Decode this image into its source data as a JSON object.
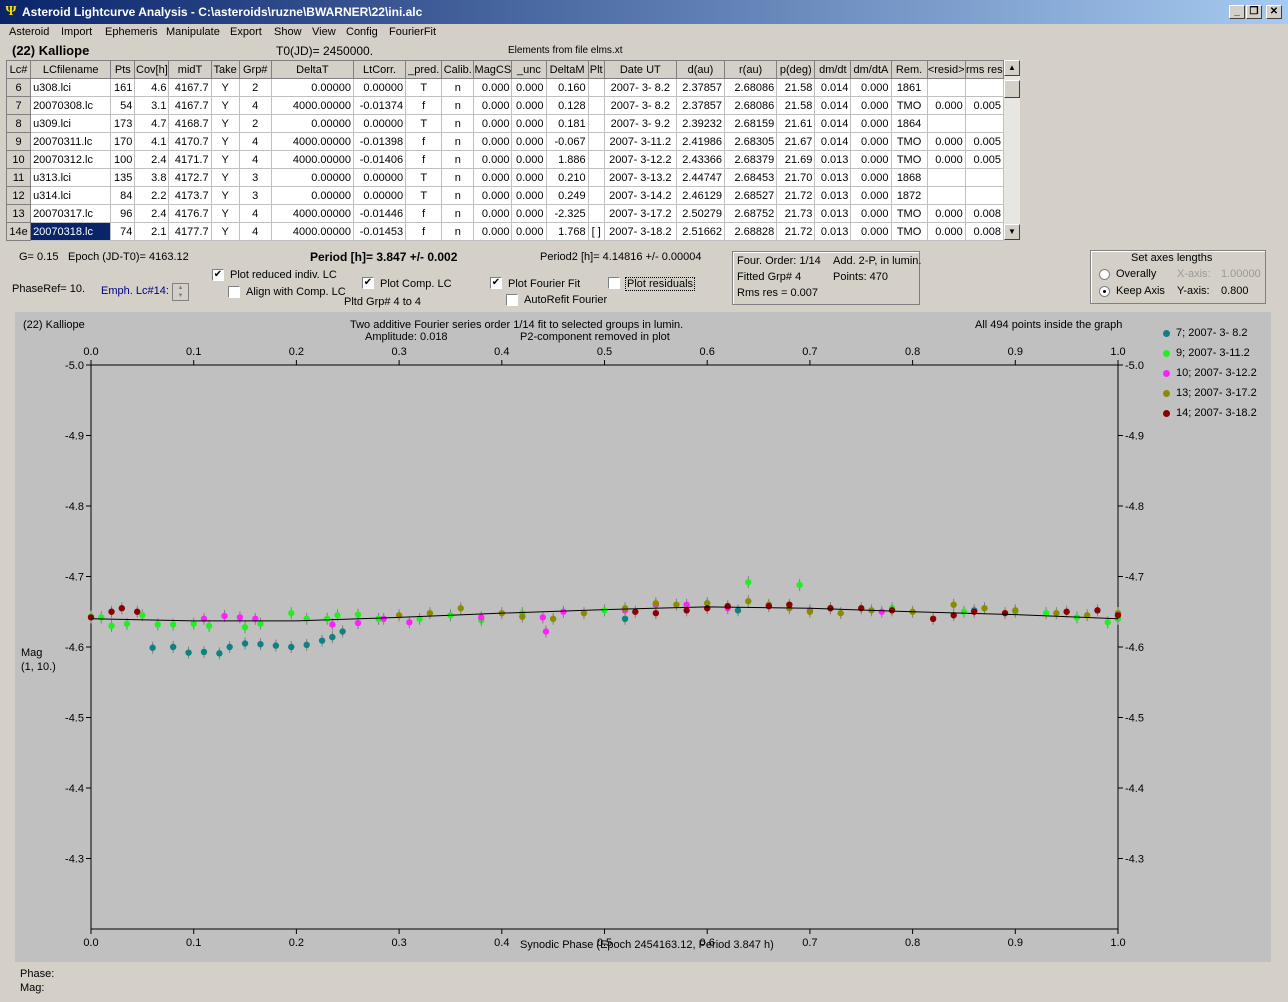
{
  "window": {
    "title": "Asteroid Lightcurve Analysis - C:\\asteroids\\ruzne\\BWARNER\\22\\ini.alc",
    "minimize": "_",
    "restore": "❐",
    "close": "✕"
  },
  "menu": [
    "Asteroid",
    "Import",
    "Ephemeris",
    "Manipulate",
    "Export",
    "Show",
    "View",
    "Config",
    "FourierFit"
  ],
  "header": {
    "asteroid": "(22) Kalliope",
    "t0": "T0(JD)= 2450000.",
    "elements": "Elements from file elms.xt"
  },
  "table": {
    "columns": [
      "Lc#",
      "LCfilename",
      "Pts",
      "Cov[h]",
      "midT",
      "Take",
      "Grp#",
      "DeltaT",
      "LtCorr.",
      "_pred.",
      "Calib.",
      "MagCS",
      "_unc",
      "DeltaM",
      "Plt",
      "Date UT",
      "d(au)",
      "r(au)",
      "p(deg)",
      "dm/dt",
      "dm/dtA",
      "Rem.",
      "<resid>",
      "rms res"
    ],
    "rows": [
      [
        "6",
        "u308.lci",
        "161",
        "4.6",
        "4167.7",
        "Y",
        "2",
        "0.00000",
        "0.00000",
        "T",
        "n",
        "0.000",
        "0.000",
        "0.160",
        "",
        "2007- 3- 8.2",
        "2.37857",
        "2.68086",
        "21.58",
        "0.014",
        "0.000",
        "1861",
        "",
        ""
      ],
      [
        "7",
        "20070308.lc",
        "54",
        "3.1",
        "4167.7",
        "Y",
        "4",
        "4000.00000",
        "-0.01374",
        "f",
        "n",
        "0.000",
        "0.000",
        "0.128",
        "",
        "2007- 3- 8.2",
        "2.37857",
        "2.68086",
        "21.58",
        "0.014",
        "0.000",
        "TMO",
        "0.000",
        "0.005"
      ],
      [
        "8",
        "u309.lci",
        "173",
        "4.7",
        "4168.7",
        "Y",
        "2",
        "0.00000",
        "0.00000",
        "T",
        "n",
        "0.000",
        "0.000",
        "0.181",
        "",
        "2007- 3- 9.2",
        "2.39232",
        "2.68159",
        "21.61",
        "0.014",
        "0.000",
        "1864",
        "",
        ""
      ],
      [
        "9",
        "20070311.lc",
        "170",
        "4.1",
        "4170.7",
        "Y",
        "4",
        "4000.00000",
        "-0.01398",
        "f",
        "n",
        "0.000",
        "0.000",
        "-0.067",
        "",
        "2007- 3-11.2",
        "2.41986",
        "2.68305",
        "21.67",
        "0.014",
        "0.000",
        "TMO",
        "0.000",
        "0.005"
      ],
      [
        "10",
        "20070312.lc",
        "100",
        "2.4",
        "4171.7",
        "Y",
        "4",
        "4000.00000",
        "-0.01406",
        "f",
        "n",
        "0.000",
        "0.000",
        "1.886",
        "",
        "2007- 3-12.2",
        "2.43366",
        "2.68379",
        "21.69",
        "0.013",
        "0.000",
        "TMO",
        "0.000",
        "0.005"
      ],
      [
        "11",
        "u313.lci",
        "135",
        "3.8",
        "4172.7",
        "Y",
        "3",
        "0.00000",
        "0.00000",
        "T",
        "n",
        "0.000",
        "0.000",
        "0.210",
        "",
        "2007- 3-13.2",
        "2.44747",
        "2.68453",
        "21.70",
        "0.013",
        "0.000",
        "1868",
        "",
        ""
      ],
      [
        "12",
        "u314.lci",
        "84",
        "2.2",
        "4173.7",
        "Y",
        "3",
        "0.00000",
        "0.00000",
        "T",
        "n",
        "0.000",
        "0.000",
        "0.249",
        "",
        "2007- 3-14.2",
        "2.46129",
        "2.68527",
        "21.72",
        "0.013",
        "0.000",
        "1872",
        "",
        ""
      ],
      [
        "13",
        "20070317.lc",
        "96",
        "2.4",
        "4176.7",
        "Y",
        "4",
        "4000.00000",
        "-0.01446",
        "f",
        "n",
        "0.000",
        "0.000",
        "-2.325",
        "",
        "2007- 3-17.2",
        "2.50279",
        "2.68752",
        "21.73",
        "0.013",
        "0.000",
        "TMO",
        "0.000",
        "0.008"
      ],
      [
        "14e",
        "20070318.lc",
        "74",
        "2.1",
        "4177.7",
        "Y",
        "4",
        "4000.00000",
        "-0.01453",
        "f",
        "n",
        "0.000",
        "0.000",
        "1.768",
        "[ ]",
        "2007- 3-18.2",
        "2.51662",
        "2.68828",
        "21.72",
        "0.013",
        "0.000",
        "TMO",
        "0.000",
        "0.008"
      ]
    ],
    "selected_row": 8
  },
  "controls": {
    "g": "G= 0.15",
    "epoch": "Epoch (JD-T0)= 4163.12",
    "period": "Period [h]= 3.847 +/- 0.002",
    "period2": "Period2 [h]= 4.14816 +/- 0.00004",
    "phaseref": "PhaseRef= 10.",
    "emph": "Emph. Lc#14:",
    "plot_reduced": {
      "label": "Plot reduced indiv. LC",
      "checked": true
    },
    "align_comp": {
      "label": "Align with Comp. LC",
      "checked": false
    },
    "plot_comp": {
      "label": "Plot Comp. LC",
      "checked": true
    },
    "pltd_grp": "Pltd Grp#  4   to   4",
    "plot_fourier": {
      "label": "Plot Fourier Fit",
      "checked": true
    },
    "autorefit": {
      "label": "AutoRefit Fourier",
      "checked": false
    },
    "plot_resid": {
      "label": "Plot residuals",
      "checked": false
    },
    "fit_info": {
      "order": "Four. Order:  1/14",
      "add": "Add. 2-P, in lumin.",
      "fitted": "Fitted Grp# 4",
      "points": "Points: 470",
      "rms": "Rms res      = 0.007"
    },
    "axes": {
      "title": "Set axes lengths",
      "overally": "Overally",
      "keep": "Keep Axis",
      "xaxis_label": "X-axis:",
      "xaxis_val": "1.00000",
      "yaxis_label": "Y-axis:",
      "yaxis_val": "0.800"
    }
  },
  "plot": {
    "name": "(22) Kalliope",
    "desc1": "Two additive Fourier series order 1/14 fit to selected groups in lumin.",
    "desc2a": "Amplitude: 0.018",
    "desc2b": "P2-component removed in plot",
    "inside": "All 494 points inside the graph",
    "ylabel1": "Mag",
    "ylabel2": "(1, 10.)",
    "xlabel": "Synodic Phase (Epoch 2454163.12, Period 3.847 h)"
  },
  "chart_data": {
    "type": "scatter",
    "xlim": [
      0.0,
      1.0
    ],
    "ylim": [
      -5.0,
      -4.2
    ],
    "y_reversed": true,
    "x_ticks": [
      "0.0",
      "0.1",
      "0.2",
      "0.3",
      "0.4",
      "0.5",
      "0.6",
      "0.7",
      "0.8",
      "0.9",
      "1.0"
    ],
    "y_ticks": [
      "-5.0",
      "-4.9",
      "-4.8",
      "-4.7",
      "-4.6",
      "-4.5",
      "-4.4",
      "-4.3"
    ],
    "legend_position": "right",
    "series": [
      {
        "name": "7; 2007- 3- 8.2",
        "color": "#108080",
        "points": [
          [
            0.06,
            -4.599
          ],
          [
            0.08,
            -4.6
          ],
          [
            0.095,
            -4.592
          ],
          [
            0.11,
            -4.593
          ],
          [
            0.125,
            -4.591
          ],
          [
            0.135,
            -4.6
          ],
          [
            0.15,
            -4.605
          ],
          [
            0.165,
            -4.604
          ],
          [
            0.18,
            -4.602
          ],
          [
            0.195,
            -4.6
          ],
          [
            0.21,
            -4.603
          ],
          [
            0.225,
            -4.609
          ],
          [
            0.235,
            -4.614
          ],
          [
            0.245,
            -4.622
          ],
          [
            0.52,
            -4.64
          ],
          [
            0.63,
            -4.652
          ],
          [
            0.86,
            -4.652
          ]
        ]
      },
      {
        "name": "9; 2007- 3-11.2",
        "color": "#20f020",
        "points": [
          [
            0.0,
            -4.643
          ],
          [
            0.01,
            -4.642
          ],
          [
            0.02,
            -4.63
          ],
          [
            0.035,
            -4.633
          ],
          [
            0.05,
            -4.645
          ],
          [
            0.065,
            -4.632
          ],
          [
            0.08,
            -4.632
          ],
          [
            0.1,
            -4.633
          ],
          [
            0.115,
            -4.63
          ],
          [
            0.15,
            -4.628
          ],
          [
            0.165,
            -4.633
          ],
          [
            0.195,
            -4.648
          ],
          [
            0.21,
            -4.64
          ],
          [
            0.23,
            -4.64
          ],
          [
            0.24,
            -4.645
          ],
          [
            0.26,
            -4.646
          ],
          [
            0.28,
            -4.64
          ],
          [
            0.32,
            -4.64
          ],
          [
            0.35,
            -4.645
          ],
          [
            0.38,
            -4.638
          ],
          [
            0.42,
            -4.648
          ],
          [
            0.5,
            -4.652
          ],
          [
            0.55,
            -4.66
          ],
          [
            0.6,
            -4.662
          ],
          [
            0.64,
            -4.692
          ],
          [
            0.69,
            -4.688
          ],
          [
            0.72,
            -4.655
          ],
          [
            0.78,
            -4.655
          ],
          [
            0.85,
            -4.65
          ],
          [
            0.9,
            -4.65
          ],
          [
            0.93,
            -4.648
          ],
          [
            0.96,
            -4.642
          ],
          [
            0.99,
            -4.635
          ],
          [
            1.0,
            -4.64
          ]
        ]
      },
      {
        "name": "10; 2007- 3-12.2",
        "color": "#ff20ff",
        "points": [
          [
            0.11,
            -4.64
          ],
          [
            0.13,
            -4.644
          ],
          [
            0.145,
            -4.642
          ],
          [
            0.16,
            -4.64
          ],
          [
            0.235,
            -4.632
          ],
          [
            0.26,
            -4.634
          ],
          [
            0.285,
            -4.64
          ],
          [
            0.31,
            -4.635
          ],
          [
            0.38,
            -4.642
          ],
          [
            0.44,
            -4.642
          ],
          [
            0.443,
            -4.622
          ],
          [
            0.46,
            -4.65
          ],
          [
            0.52,
            -4.652
          ],
          [
            0.55,
            -4.66
          ],
          [
            0.58,
            -4.66
          ],
          [
            0.62,
            -4.655
          ],
          [
            0.7,
            -4.652
          ],
          [
            0.77,
            -4.65
          ]
        ]
      },
      {
        "name": "13; 2007- 3-17.2",
        "color": "#8b8b00",
        "points": [
          [
            0.3,
            -4.645
          ],
          [
            0.33,
            -4.648
          ],
          [
            0.36,
            -4.655
          ],
          [
            0.4,
            -4.648
          ],
          [
            0.42,
            -4.643
          ],
          [
            0.45,
            -4.64
          ],
          [
            0.48,
            -4.648
          ],
          [
            0.52,
            -4.655
          ],
          [
            0.55,
            -4.662
          ],
          [
            0.57,
            -4.66
          ],
          [
            0.6,
            -4.662
          ],
          [
            0.64,
            -4.665
          ],
          [
            0.66,
            -4.66
          ],
          [
            0.68,
            -4.655
          ],
          [
            0.7,
            -4.65
          ],
          [
            0.73,
            -4.648
          ],
          [
            0.76,
            -4.652
          ],
          [
            0.8,
            -4.65
          ],
          [
            0.84,
            -4.66
          ],
          [
            0.87,
            -4.655
          ],
          [
            0.9,
            -4.652
          ],
          [
            0.94,
            -4.648
          ],
          [
            0.97,
            -4.645
          ],
          [
            1.0,
            -4.648
          ]
        ]
      },
      {
        "name": "14; 2007- 3-18.2",
        "color": "#8b0000",
        "points": [
          [
            0.0,
            -4.642
          ],
          [
            0.02,
            -4.65
          ],
          [
            0.03,
            -4.655
          ],
          [
            0.045,
            -4.65
          ],
          [
            0.53,
            -4.65
          ],
          [
            0.55,
            -4.648
          ],
          [
            0.58,
            -4.652
          ],
          [
            0.6,
            -4.655
          ],
          [
            0.62,
            -4.658
          ],
          [
            0.66,
            -4.658
          ],
          [
            0.68,
            -4.66
          ],
          [
            0.72,
            -4.655
          ],
          [
            0.75,
            -4.655
          ],
          [
            0.78,
            -4.652
          ],
          [
            0.82,
            -4.64
          ],
          [
            0.84,
            -4.645
          ],
          [
            0.86,
            -4.65
          ],
          [
            0.89,
            -4.648
          ],
          [
            0.95,
            -4.65
          ],
          [
            0.98,
            -4.652
          ],
          [
            1.0,
            -4.645
          ]
        ]
      }
    ],
    "fit_curve": {
      "color": "#000000",
      "points": [
        [
          0.0,
          -4.64
        ],
        [
          0.1,
          -4.637
        ],
        [
          0.2,
          -4.637
        ],
        [
          0.3,
          -4.642
        ],
        [
          0.4,
          -4.648
        ],
        [
          0.5,
          -4.653
        ],
        [
          0.6,
          -4.657
        ],
        [
          0.7,
          -4.655
        ],
        [
          0.8,
          -4.65
        ],
        [
          0.9,
          -4.646
        ],
        [
          1.0,
          -4.64
        ]
      ]
    }
  },
  "footer": {
    "phase": "Phase:",
    "mag": "Mag:"
  }
}
